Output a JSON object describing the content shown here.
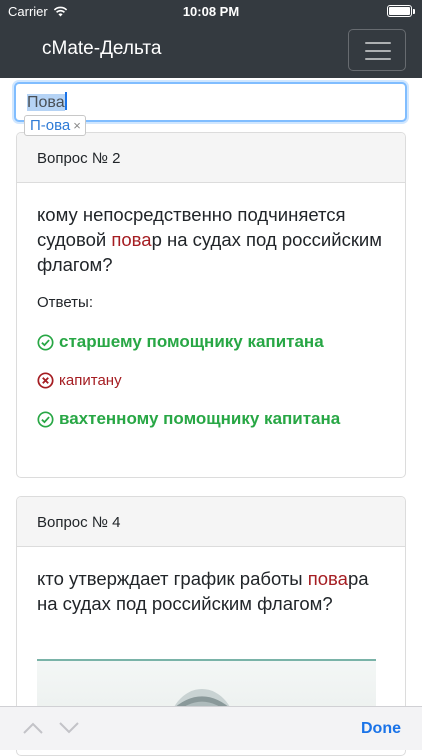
{
  "status_bar": {
    "carrier": "Carrier",
    "time": "10:08 PM"
  },
  "navbar": {
    "brand": "cMate-Дельта",
    "menu_icon": "hamburger-icon"
  },
  "search": {
    "value_selected": "Пова",
    "chip_label": "П-ова",
    "chip_close": "×"
  },
  "cards": [
    {
      "header": "Вопрос № 2",
      "question_parts": [
        "кому непосредственно подчиняется судовой ",
        "пова",
        "р на судах под российским флагом?"
      ],
      "answers_label": "Ответы:",
      "answers": [
        {
          "text": "старшему помощнику капитана",
          "status": "correct"
        },
        {
          "text": "капитану",
          "status": "wrong"
        },
        {
          "text": "вахтенному помощнику капитана",
          "status": "correct"
        }
      ]
    },
    {
      "header": "Вопрос № 4",
      "question_parts": [
        "кто утверждает график работы ",
        "пова",
        "ра на судах под российским флагом?"
      ]
    }
  ],
  "accessory": {
    "done_label": "Done"
  },
  "colors": {
    "navbar": "#343a40",
    "correct": "#28a745",
    "wrong": "#a51d22",
    "link": "#1a73e8"
  }
}
